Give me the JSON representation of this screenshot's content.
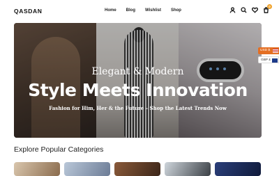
{
  "brand": "QASDAN",
  "nav": [
    "Home",
    "Blog",
    "Wishlist",
    "Shop"
  ],
  "icons": [
    "user-icon",
    "search-icon",
    "heart-icon",
    "cart-icon"
  ],
  "cart_count": "0",
  "hero": {
    "kicker": "Elegant & Modern",
    "title": "Style Meets Innovation",
    "subtitle": "Fashion for Him, Her & the Future – Shop the Latest Trends Now"
  },
  "currencies": [
    {
      "label": "USD $",
      "flag": "us-flag-icon"
    },
    {
      "label": "GBP £",
      "flag": "gb-flag-icon"
    }
  ],
  "section_title": "Explore Popular Categories",
  "colors": {
    "accent": "#e46f23",
    "badge": "#f0a22a"
  }
}
